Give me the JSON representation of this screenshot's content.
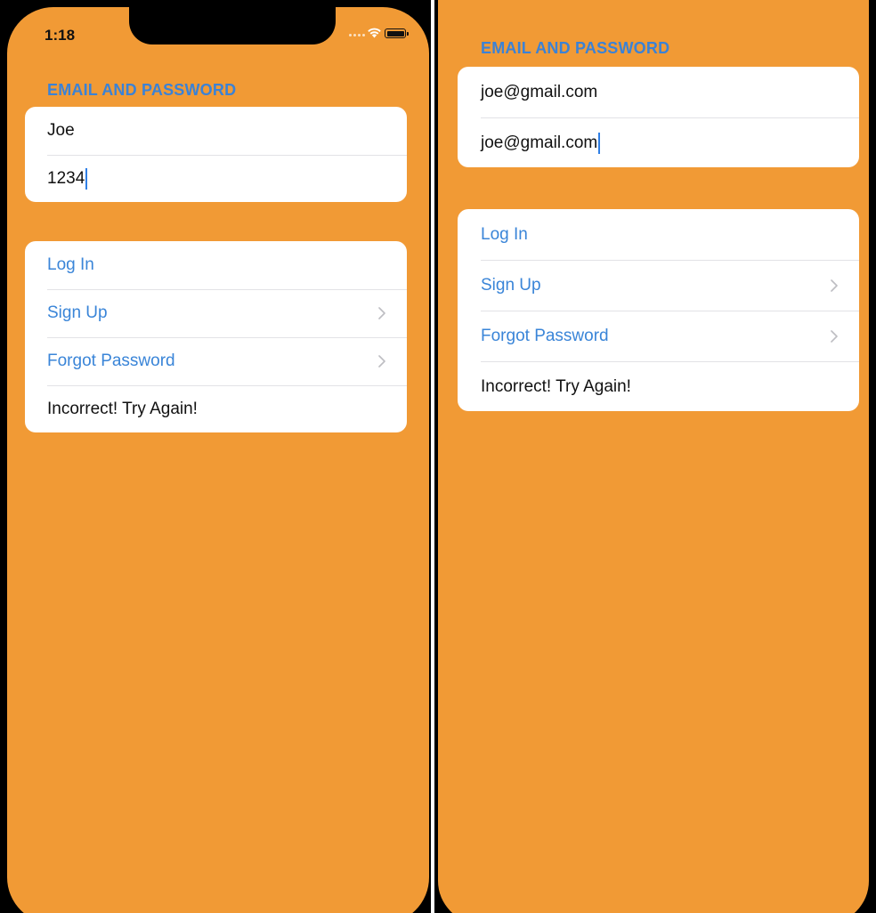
{
  "left_screen": {
    "status_bar": {
      "time": "1:18"
    },
    "section_header": "EMAIL AND  PASSWORD",
    "fields": {
      "email_value": "Joe",
      "password_value": "1234"
    },
    "actions": {
      "login_label": "Log In",
      "signup_label": "Sign Up",
      "forgot_label": "Forgot Password",
      "message": "Incorrect! Try Again!"
    }
  },
  "right_screen": {
    "section_header": "EMAIL AND  PASSWORD",
    "fields": {
      "email_value": "joe@gmail.com",
      "password_value": "joe@gmail.com"
    },
    "actions": {
      "login_label": "Log In",
      "signup_label": "Sign Up",
      "forgot_label": "Forgot Password",
      "message": "Incorrect! Try Again!"
    }
  },
  "colors": {
    "background": "#f19a35",
    "accent": "#3a85d8",
    "card": "#ffffff"
  },
  "icons": [
    "wifi-icon",
    "battery-icon",
    "chevron-right-icon"
  ]
}
